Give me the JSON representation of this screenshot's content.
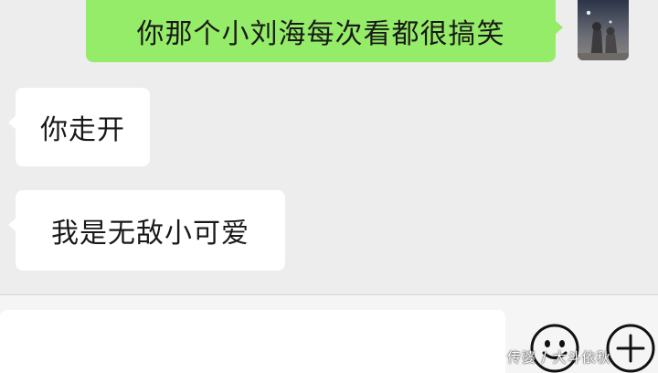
{
  "colors": {
    "background": "#ededed",
    "outgoing_bubble": "#95ec69",
    "incoming_bubble": "#ffffff",
    "input_bar": "#f5f5f5"
  },
  "messages": [
    {
      "direction": "outgoing",
      "text": "你那个小刘海每次看都很搞笑"
    },
    {
      "direction": "incoming",
      "text": "你走开"
    },
    {
      "direction": "incoming",
      "text": "我是无敌小可爱"
    }
  ],
  "input": {
    "value": ""
  },
  "icons": {
    "emoji": "smiley-face-icon",
    "more": "plus-circle-icon"
  },
  "watermark": {
    "text": "传婆 / 大斗依秋"
  }
}
